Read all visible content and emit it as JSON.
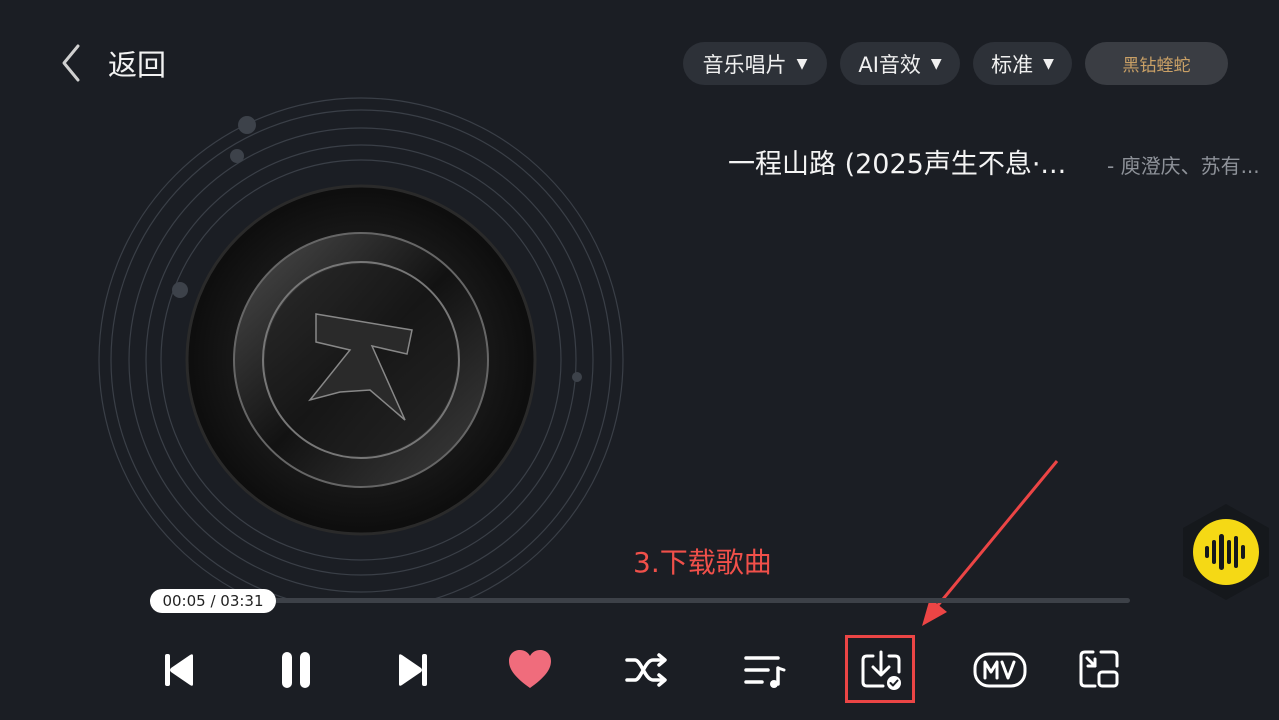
{
  "header": {
    "back_label": "返回",
    "chips": [
      {
        "label": "音乐唱片",
        "arrow": "▼"
      },
      {
        "label": "AI音效",
        "arrow": "▼"
      },
      {
        "label": "标准",
        "arrow": "▼"
      }
    ],
    "vip_label": "黑钻蝰蛇"
  },
  "song": {
    "title": "一程山路 (2025声生不息·...",
    "artist": "- 庾澄庆、苏有..."
  },
  "player": {
    "time": "00:05 / 03:31",
    "progress": 0.024,
    "liked": true
  },
  "annotation": {
    "text": "3.下载歌曲"
  },
  "colors": {
    "background": "#1b1e24",
    "heart": "#f06c7c",
    "annotation": "#f0504a",
    "vip_text": "#c9a066",
    "voice_button": "#f5d915"
  },
  "controls": [
    {
      "name": "previous-button",
      "icon": "skip-previous-icon"
    },
    {
      "name": "pause-button",
      "icon": "pause-icon"
    },
    {
      "name": "next-button",
      "icon": "skip-next-icon"
    },
    {
      "name": "like-button",
      "icon": "heart-icon"
    },
    {
      "name": "shuffle-button",
      "icon": "shuffle-icon"
    },
    {
      "name": "playlist-button",
      "icon": "playlist-icon"
    },
    {
      "name": "download-button",
      "icon": "download-icon"
    },
    {
      "name": "mv-button",
      "icon": "mv-icon"
    },
    {
      "name": "mini-player-button",
      "icon": "picture-in-picture-icon"
    }
  ]
}
